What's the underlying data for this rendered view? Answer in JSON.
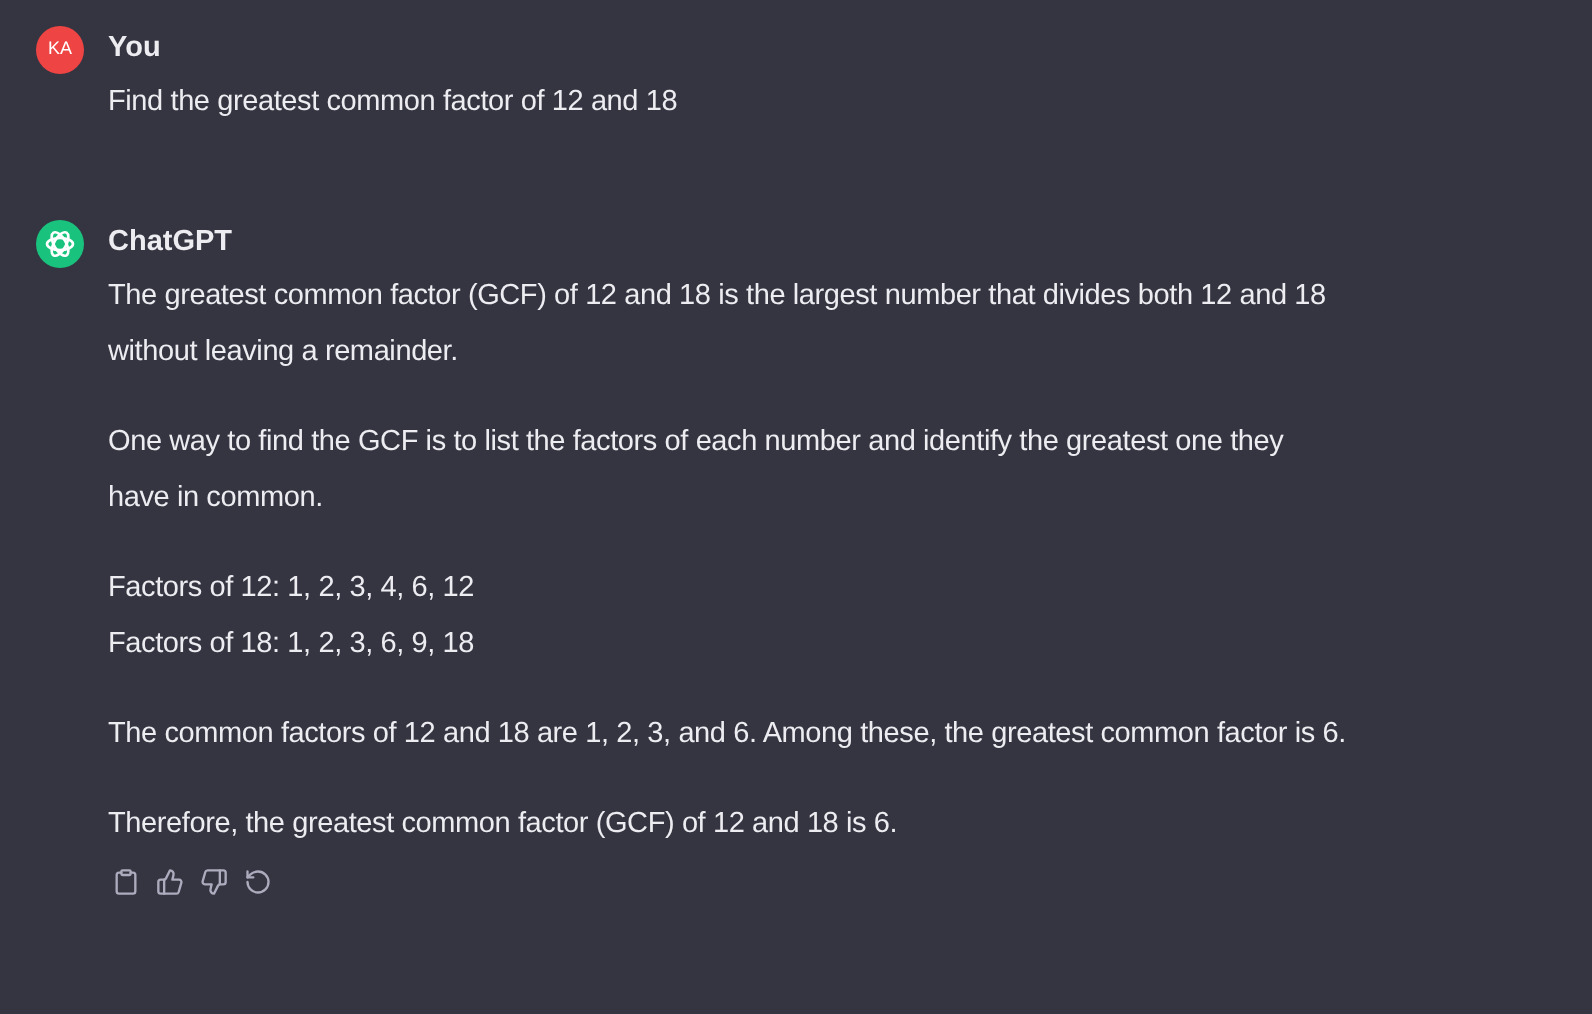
{
  "messages": [
    {
      "kind": "user",
      "avatar": "KA",
      "author": "You",
      "paragraphs": [
        [
          "Find the greatest common factor of 12 and 18"
        ]
      ]
    },
    {
      "kind": "assistant",
      "author": "ChatGPT",
      "paragraphs": [
        [
          "The greatest common factor (GCF) of 12 and 18 is the largest number that divides both 12 and 18 without leaving a remainder."
        ],
        [
          "One way to find the GCF is to list the factors of each number and identify the greatest one they have in common."
        ],
        [
          "Factors of 12: 1, 2, 3, 4, 6, 12",
          "Factors of 18: 1, 2, 3, 6, 9, 18"
        ],
        [
          "The common factors of 12 and 18 are 1, 2, 3, and 6. Among these, the greatest common factor is 6."
        ],
        [
          "Therefore, the greatest common factor (GCF) of 12 and 18 is 6."
        ]
      ]
    }
  ]
}
